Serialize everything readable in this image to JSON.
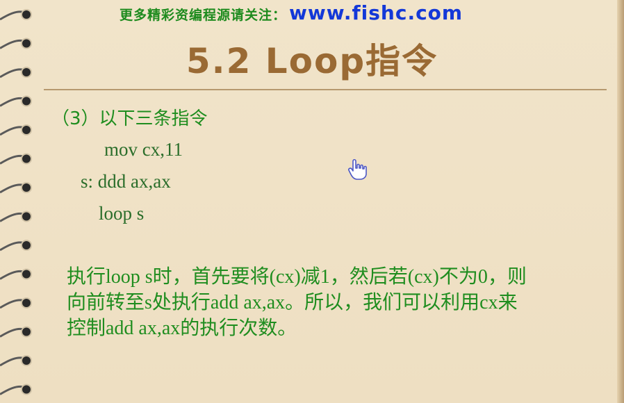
{
  "header": {
    "promo_text": "更多精彩资编程源请关注：",
    "promo_url": "www.fishc.com"
  },
  "slide": {
    "title": "5.2 Loop指令",
    "subheading": "（3）以下三条指令",
    "code_lines": [
      "mov cx,11",
      "s: ddd ax,ax",
      "loop s"
    ],
    "explanation_lines": [
      "执行loop s时，首先要将(cx)减1，然后若(cx)不为0，则",
      "向前转至s处执行add ax,ax。所以，我们可以利用cx来",
      "控制add ax,ax的执行次数。"
    ]
  },
  "colors": {
    "background": "#efe1c6",
    "title": "#9a6a34",
    "green_text": "#1f8d1f",
    "url_blue": "#1338d8"
  },
  "icons": {
    "cursor": "hand-pointer-icon",
    "binding": "spiral-binding"
  }
}
